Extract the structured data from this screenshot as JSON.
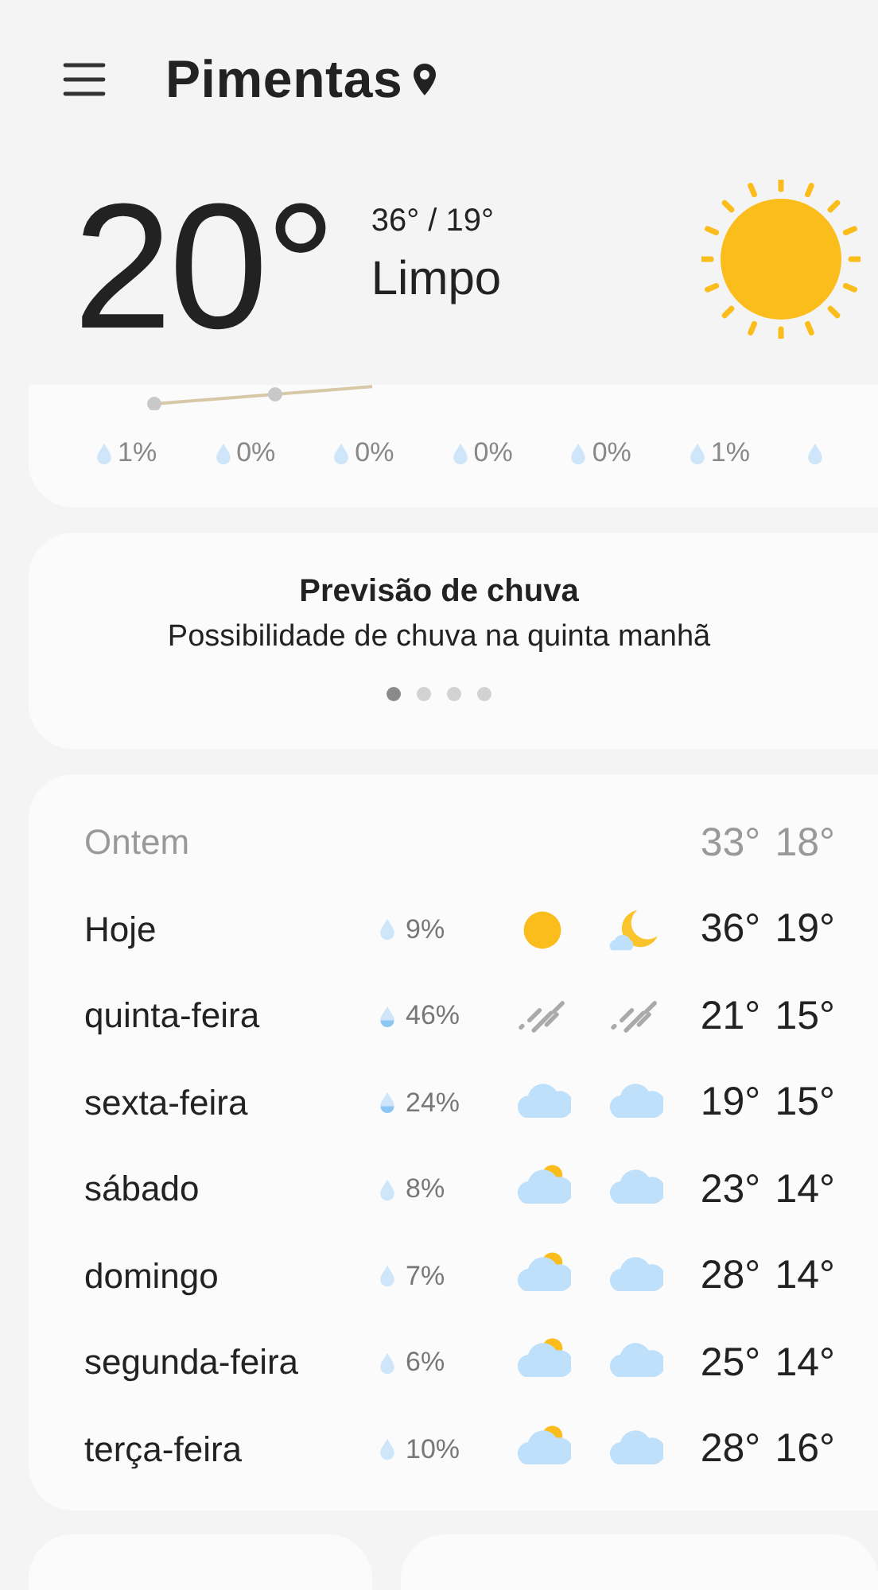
{
  "header": {
    "city": "Pimentas"
  },
  "current": {
    "temperature": "20°",
    "high_low": "36° / 19°",
    "condition": "Limpo"
  },
  "hourly": [
    {
      "kind": "chance",
      "chance": "1%"
    },
    {
      "kind": "chance",
      "chance": "0%"
    },
    {
      "kind": "chance",
      "chance": "0%"
    },
    {
      "kind": "chance",
      "chance": "0%"
    },
    {
      "kind": "chance",
      "chance": "0%"
    },
    {
      "kind": "chance",
      "chance": "1%"
    },
    {
      "kind": "cut"
    }
  ],
  "rain_card": {
    "title": "Previsão de chuva",
    "text": "Possibilidade de chuva na quinta manhã",
    "pages": [
      {
        "selected": true
      },
      {
        "selected": false
      },
      {
        "selected": false
      },
      {
        "selected": false
      }
    ]
  },
  "daily": [
    {
      "kind": "past",
      "day": "Ontem",
      "high": "33°",
      "low": "18°"
    },
    {
      "kind": "forecast",
      "day": "Hoje",
      "chance": "9%",
      "high": "36°",
      "low": "19°"
    },
    {
      "kind": "forecast",
      "day": "quinta-feira",
      "chance": "46%",
      "high": "21°",
      "low": "15°"
    },
    {
      "kind": "forecast",
      "day": "sexta-feira",
      "chance": "24%",
      "high": "19°",
      "low": "15°"
    },
    {
      "kind": "forecast",
      "day": "sábado",
      "chance": "8%",
      "high": "23°",
      "low": "14°"
    },
    {
      "kind": "forecast",
      "day": "domingo",
      "chance": "7%",
      "high": "28°",
      "low": "14°"
    },
    {
      "kind": "forecast",
      "day": "segunda-feira",
      "chance": "6%",
      "high": "25°",
      "low": "14°"
    },
    {
      "kind": "forecast",
      "day": "terça-feira",
      "chance": "10%",
      "high": "28°",
      "low": "16°"
    }
  ]
}
